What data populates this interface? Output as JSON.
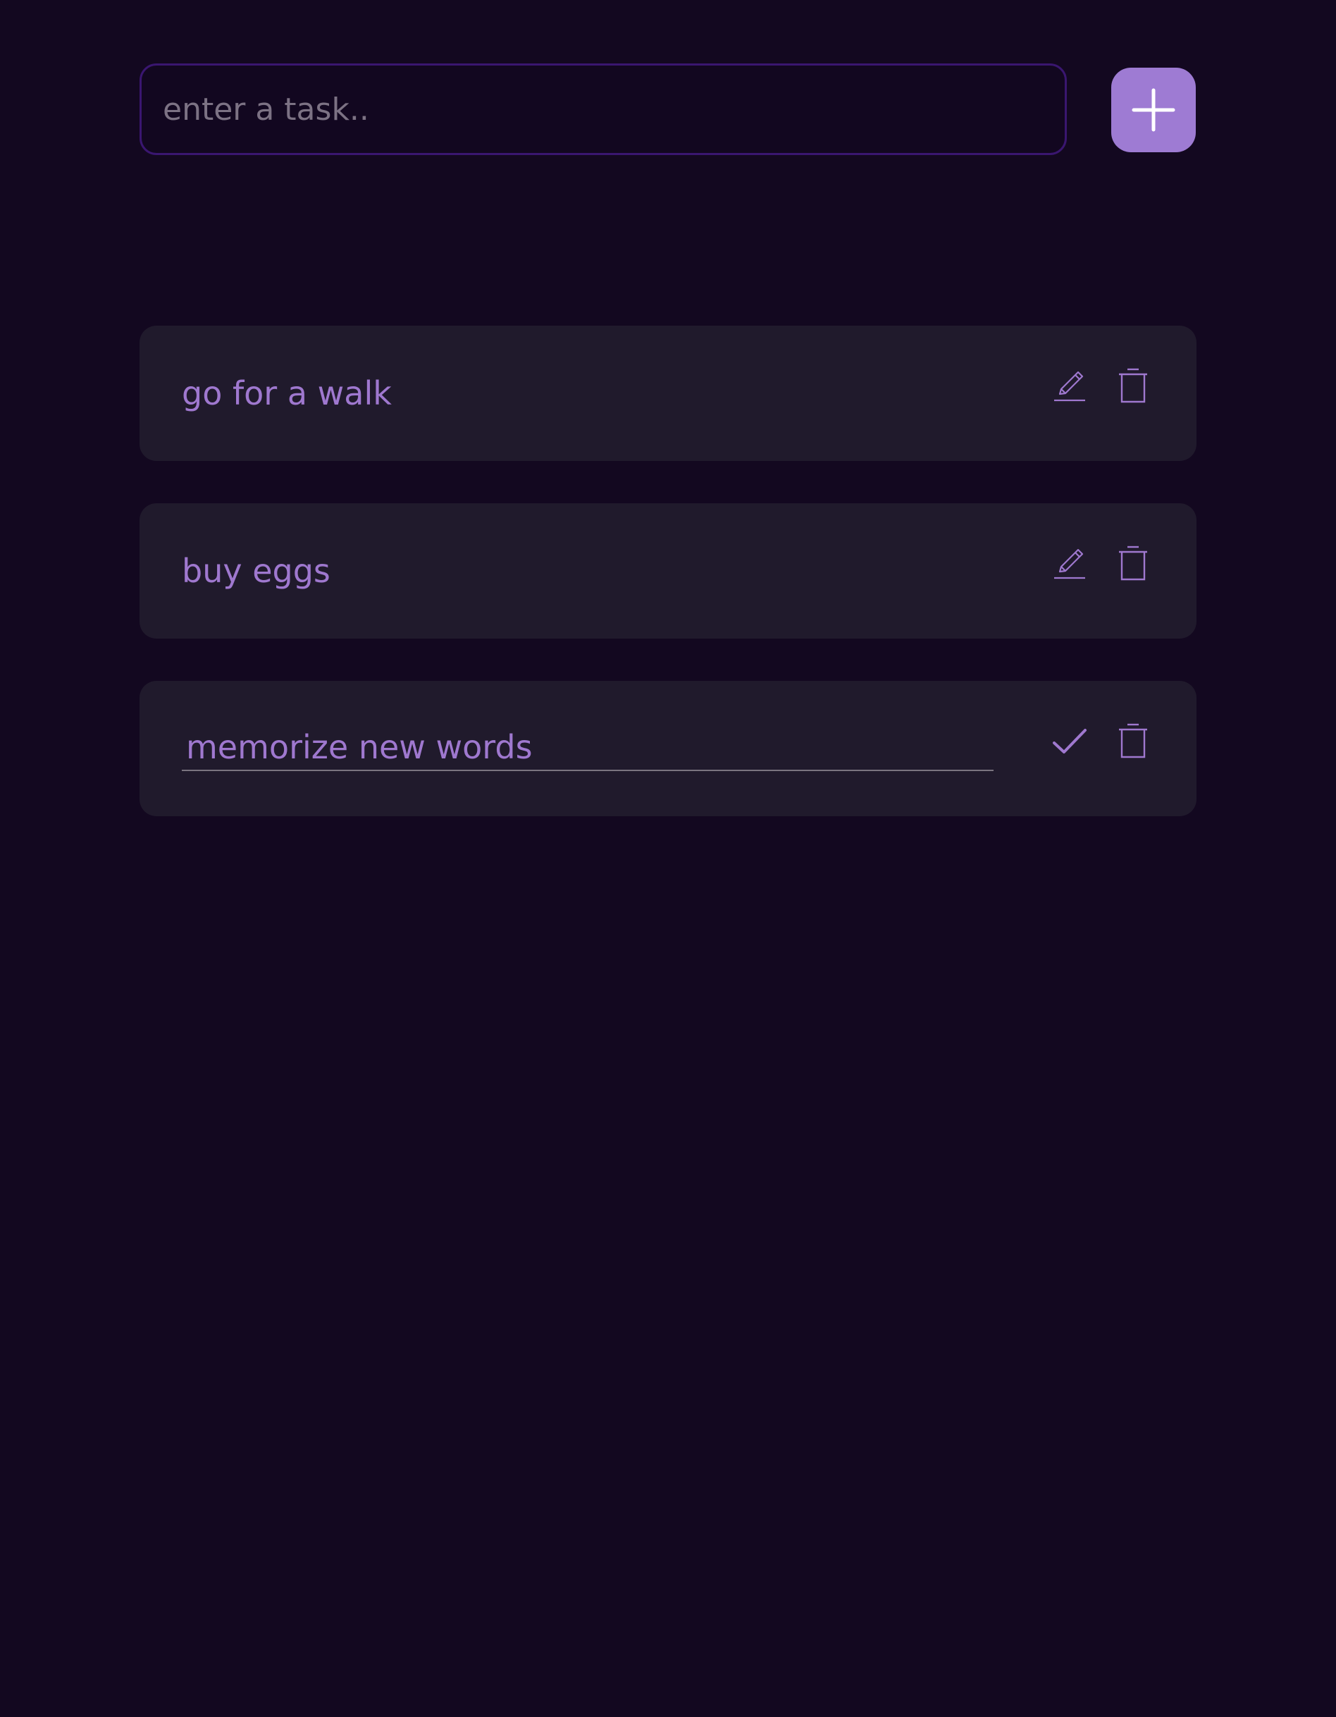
{
  "input": {
    "placeholder": "enter a task..",
    "value": ""
  },
  "add_button": {
    "icon": "plus-icon"
  },
  "tasks": [
    {
      "text": "go for a walk",
      "editing": false,
      "actions": [
        "pencil-icon",
        "trash-icon"
      ]
    },
    {
      "text": "buy eggs",
      "editing": false,
      "actions": [
        "pencil-icon",
        "trash-icon"
      ]
    },
    {
      "text": "memorize new words",
      "editing": true,
      "actions": [
        "check-icon",
        "trash-icon"
      ]
    }
  ],
  "colors": {
    "background": "#130820",
    "input_border": "#3a1670",
    "accent": "#9e7bd3",
    "card": "#201a2c",
    "task_text": "#9f78cf",
    "placeholder": "#7c7284"
  }
}
